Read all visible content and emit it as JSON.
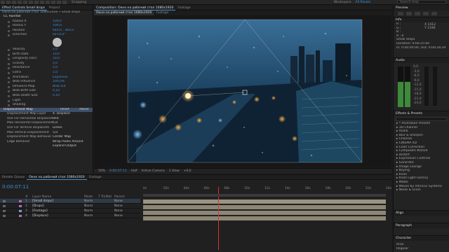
{
  "topbar": {
    "snapping": "Snapping",
    "workspaces": [
      "Workspace",
      "All Panels"
    ],
    "search_placeholder": "Search Help"
  },
  "effect_controls": {
    "tabs": [
      "Effect Controls Small drops",
      "Project"
    ],
    "breadcrumb": "Окно на рабочий стол 1080x1920 • Small drops",
    "effect_name": "CC Rainfall",
    "properties": [
      {
        "name": "Radius X",
        "value": "100,0"
      },
      {
        "name": "Radius Y",
        "value": "100,0"
      },
      {
        "name": "Position",
        "value": "640,0 , 360,0"
      },
      {
        "name": "Direction",
        "value": "0x+0,0°"
      },
      {
        "name": "Velocity",
        "value": "2,0"
      },
      {
        "name": "Birth Rate",
        "value": "10,0"
      },
      {
        "name": "Longevity (sec)",
        "value": "10,0"
      },
      {
        "name": "Gravity",
        "value": "5,0"
      },
      {
        "name": "Resistance",
        "value": "5,0"
      },
      {
        "name": "Extra",
        "value": "1,0"
      },
      {
        "name": "Animation",
        "value": "Explosive"
      },
      {
        "name": "Blob Influence",
        "value": "100,0%"
      },
      {
        "name": "Influence Map",
        "value": "Blob out"
      },
      {
        "name": "Blob Birth Size",
        "value": "0,10"
      },
      {
        "name": "Blob Death Size",
        "value": "0,10"
      },
      {
        "name": "Light",
        "value": ""
      },
      {
        "name": "Shading",
        "value": ""
      }
    ],
    "displacement": {
      "name": "Displacement Map",
      "reset": "Reset",
      "about": "About",
      "props": [
        {
          "name": "Displacement Map Layer",
          "value": "4. Displace"
        },
        {
          "name": "Use For Horizontal Displacem",
          "value": "Red"
        },
        {
          "name": "Max Horizontal Displacement",
          "value": "5,0"
        },
        {
          "name": "Use For Vertical Displacem",
          "value": "Green"
        },
        {
          "name": "Max Vertical Displacement",
          "value": "5,0"
        },
        {
          "name": "Displacement Map Behavior",
          "value": "Center Map"
        },
        {
          "name": "Edge Behavior",
          "value": "Wrap Pixels Around"
        },
        {
          "name": "",
          "value": "Expand Output"
        }
      ]
    }
  },
  "composition": {
    "tabs": [
      "Composition: Окно на рабочий стол 1080x1920",
      "Footage"
    ],
    "subtab": "Окно на рабочий стол 1080x1920",
    "footage_tab": "Footage",
    "zoom": "50%",
    "timecode": "0:00:07:11",
    "resolution": "Half",
    "camera": "Active Camera",
    "views": "1 View",
    "offset": "+0,0"
  },
  "right_panel": {
    "preview": "Preview",
    "info": {
      "title": "Info",
      "lines": [
        "R :",
        "G :",
        "B :",
        "A : 0",
        "Small drops",
        "Duration: 0:00:25:00",
        "In: 0:00:00:00, Out: 0:00:24:29"
      ],
      "coords": [
        "X 1412",
        "Y 1190"
      ]
    },
    "audio": {
      "title": "Audio",
      "scale": [
        "0,0",
        "-3,0",
        "-6,0",
        "-9,0",
        "-12,0",
        "-15,0",
        "-18,0",
        "-21,0",
        "-24,0"
      ]
    },
    "effects": {
      "title": "Effects & Presets",
      "items": [
        "* Animation Presets",
        "3D Channel",
        "Audio",
        "Blur & Sharpen",
        "Channel",
        "CINEMA 4D",
        "Color Correction",
        "Composite Wizard",
        "Distort",
        "Expression Controls",
        "Generate",
        "Image Lounge",
        "Keying",
        "Knoll",
        "Knoll Light Factory",
        "Matte",
        "Moves by Intrinsic Systems",
        "Noise & Grain"
      ]
    },
    "align": "Align",
    "paragraph": "Paragraph",
    "character": {
      "title": "Character",
      "font": "Arial",
      "style": "Regular"
    }
  },
  "timeline": {
    "tabs": [
      "Render Queue",
      "Окно на рабочий стол 1080x1920",
      "Footage"
    ],
    "timecode": "0:00:07:11",
    "columns": [
      "#",
      "Layer Name",
      "Mode",
      "T TrkMat",
      "Parent"
    ],
    "layers": [
      {
        "num": "1",
        "name": "[Small drops]",
        "mode": "Norm",
        "parent": "None",
        "color": "#b36bb0",
        "selected": true
      },
      {
        "num": "2",
        "name": "[Drops]",
        "mode": "Norm",
        "parent": "None",
        "color": "#b36bb0",
        "selected": false
      },
      {
        "num": "3",
        "name": "[Footage]",
        "mode": "Norm",
        "parent": "None",
        "color": "#7c9fc7",
        "selected": false
      },
      {
        "num": "4",
        "name": "[Displace]",
        "mode": "Norm",
        "parent": "None",
        "color": "#b36bb0",
        "selected": false
      }
    ],
    "ruler": [
      "0s",
      "02s",
      "04s",
      "06s",
      "08s",
      "10s",
      "12s",
      "14s",
      "16s",
      "18s",
      "20s",
      "22s",
      "24s"
    ],
    "playhead_sec": 7.45
  }
}
